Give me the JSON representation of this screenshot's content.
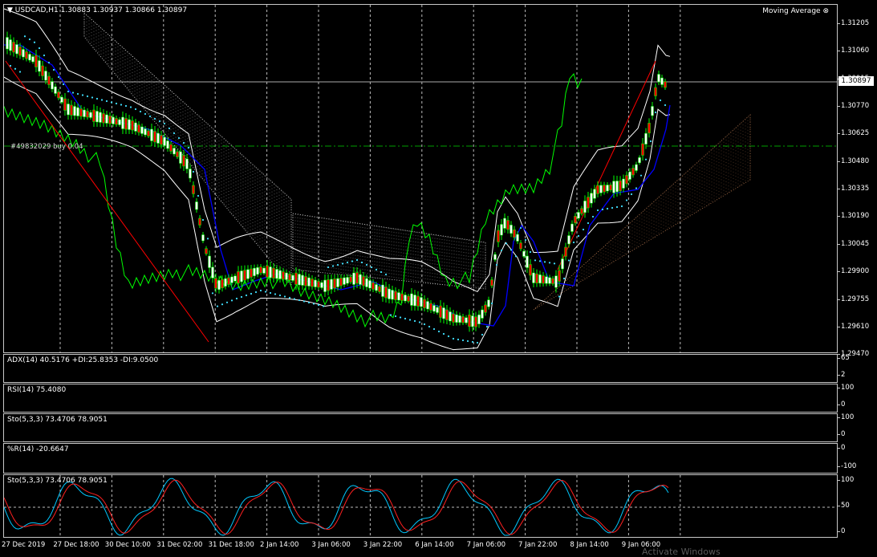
{
  "main_chart": {
    "symbol_line": "USDCAD,H1  1.30883 1.30937 1.30866 1.30897",
    "indicator_title": "Moving Average",
    "current_price": "1.30897",
    "order_label": "#49832029 buy 0.04",
    "price_ticks": [
      "1.31205",
      "1.31060",
      "1.30915",
      "1.30770",
      "1.30625",
      "1.30480",
      "1.30335",
      "1.30190",
      "1.30045",
      "1.29900",
      "1.29755",
      "1.29610",
      "1.29470"
    ]
  },
  "subpanes": [
    {
      "label": "ADX(14) 40.5176 +DI:25.8353 -DI:9.0500",
      "ticks": [
        "65",
        "2"
      ]
    },
    {
      "label": "RSI(14) 75.4080",
      "ticks": [
        "100",
        "0"
      ]
    },
    {
      "label": "Sto(5,3,3) 73.4706 78.9051",
      "ticks": [
        "100",
        "0"
      ]
    },
    {
      "label": "%R(14) -20.6647",
      "ticks": [
        "0",
        "-100"
      ]
    },
    {
      "label": "Sto(5,3,3) 73.4706 78.9051",
      "ticks": [
        "100",
        "50",
        "0"
      ]
    }
  ],
  "time_axis": [
    "27 Dec 2019",
    "27 Dec 18:00",
    "30 Dec 10:00",
    "31 Dec 02:00",
    "31 Dec 18:00",
    "2 Jan 14:00",
    "3 Jan 06:00",
    "3 Jan 22:00",
    "6 Jan 14:00",
    "7 Jan 06:00",
    "7 Jan 22:00",
    "8 Jan 14:00",
    "9 Jan 06:00"
  ],
  "watermark": "Activate Windows",
  "colors": {
    "bull": "#00ff00",
    "bear": "#ff0000",
    "ma_blue": "#0000ff",
    "bands": "#ffffff",
    "cloud_a": "#ffffff",
    "cloud_b": "#d08a5a",
    "sar": "#40e0ff",
    "stoch_main": "#00c8ff",
    "stoch_signal": "#ff2020"
  }
}
